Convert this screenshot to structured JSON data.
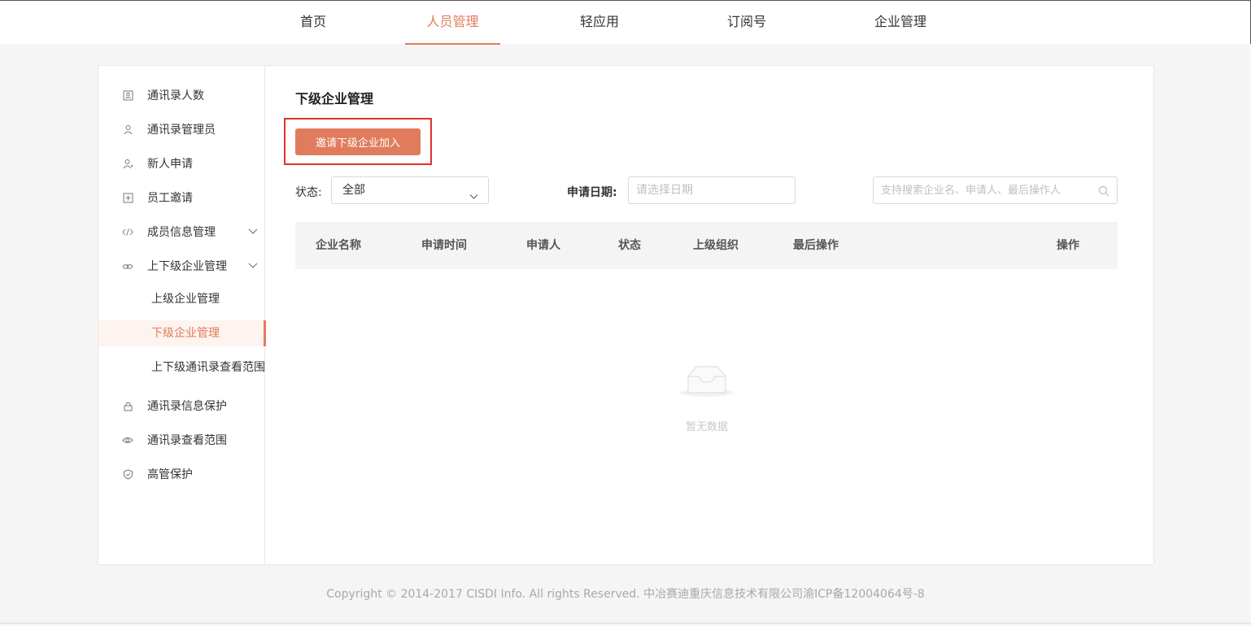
{
  "topnav": {
    "items": [
      {
        "label": "首页",
        "active": false
      },
      {
        "label": "人员管理",
        "active": true
      },
      {
        "label": "轻应用",
        "active": false
      },
      {
        "label": "订阅号",
        "active": false
      },
      {
        "label": "企业管理",
        "active": false
      }
    ]
  },
  "sidebar": {
    "items": [
      {
        "label": "通讯录人数",
        "icon": "contacts-icon"
      },
      {
        "label": "通讯录管理员",
        "icon": "admin-user-icon"
      },
      {
        "label": "新人申请",
        "icon": "new-user-icon"
      },
      {
        "label": "员工邀请",
        "icon": "plus-box-icon"
      },
      {
        "label": "成员信息管理",
        "icon": "code-icon"
      },
      {
        "label": "上下级企业管理",
        "icon": "link-icon"
      }
    ],
    "subitems": [
      {
        "label": "上级企业管理",
        "active": false
      },
      {
        "label": "下级企业管理",
        "active": true
      },
      {
        "label": "上下级通讯录查看范围",
        "active": false
      }
    ],
    "items_bottom": [
      {
        "label": "通讯录信息保护",
        "icon": "lock-icon"
      },
      {
        "label": "通讯录查看范围",
        "icon": "eye-icon"
      },
      {
        "label": "高管保护",
        "icon": "shield-icon"
      }
    ]
  },
  "main": {
    "title": "下级企业管理",
    "invite_button": "邀请下级企业加入",
    "filters": {
      "status_label": "状态:",
      "status_value": "全部",
      "date_label": "申请日期:",
      "date_placeholder": "请选择日期",
      "search_placeholder": "支持搜索企业名、申请人、最后操作人"
    },
    "table": {
      "columns": [
        "企业名称",
        "申请时间",
        "申请人",
        "状态",
        "上级组织",
        "最后操作",
        "操作"
      ],
      "rows": [],
      "empty_text": "暂无数据"
    }
  },
  "footer": {
    "text": "Copyright © 2014-2017 CISDI Info. All rights Reserved. 中冶赛迪重庆信息技术有限公司渝ICP备12004064号-8"
  },
  "colors": {
    "accent": "#e07c5c",
    "highlight_border": "#e0322d"
  }
}
